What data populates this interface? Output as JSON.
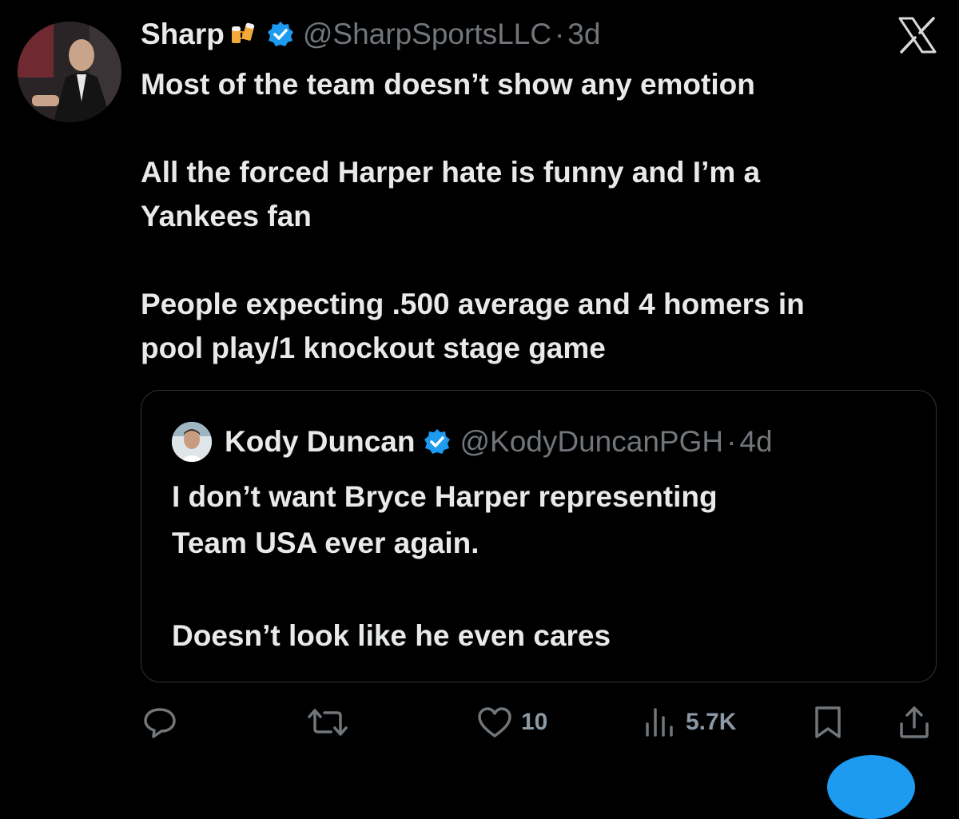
{
  "tweet": {
    "display_name": "Sharp",
    "emoji": "beer-mugs-icon",
    "handle": "@SharpSportsLLC",
    "separator": "·",
    "time": "3d",
    "text": "Most of the team doesn’t show any emotion\n\nAll the forced Harper hate is funny and I’m a\nYankees fan\n\nPeople expecting .500 average and 4 homers in\npool play/1 knockout stage game"
  },
  "quoted_tweet": {
    "display_name": "Kody Duncan",
    "handle": "@KodyDuncanPGH",
    "separator": "·",
    "time": "4d",
    "text": "I don’t want Bryce Harper representing\nTeam USA ever again.\n\nDoesn’t look like he even cares"
  },
  "actions": {
    "reply": {
      "icon": "reply-icon",
      "count": ""
    },
    "retweet": {
      "icon": "retweet-icon",
      "count": ""
    },
    "like": {
      "icon": "heart-icon",
      "count": "10"
    },
    "views": {
      "icon": "views-icon",
      "count": "5.7K"
    },
    "bookmark": {
      "icon": "bookmark-icon"
    },
    "share": {
      "icon": "share-icon"
    }
  },
  "colors": {
    "background": "#000000",
    "text": "#e7e9ea",
    "muted": "#71767b",
    "verified": "#1d9bf0",
    "border": "#2f3336"
  }
}
